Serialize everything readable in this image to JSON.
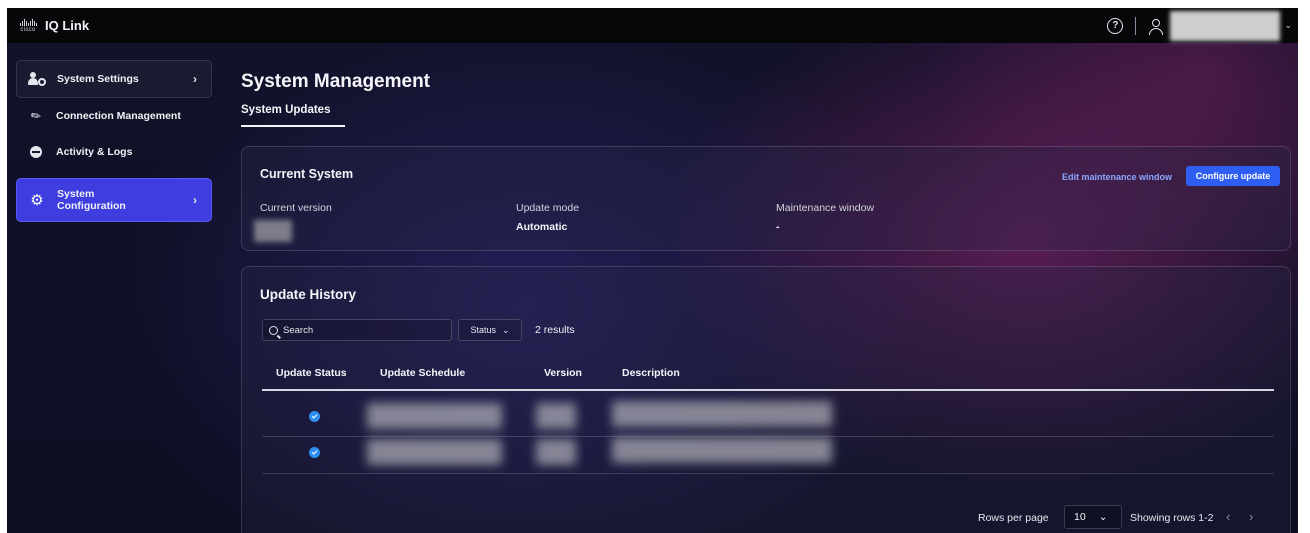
{
  "app": {
    "name": "IQ Link",
    "logo_text": "cisco"
  },
  "topbar": {
    "help_icon": "help-circle-icon",
    "user_icon": "user-icon",
    "chevron": "chevron-down-icon"
  },
  "sidebar": {
    "items": [
      {
        "label": "System Settings",
        "icon": "users-gear-icon",
        "has_chevron": true
      },
      {
        "label": "Connection Management",
        "icon": "plug-icon"
      },
      {
        "label": "Activity & Logs",
        "icon": "activity-icon"
      },
      {
        "label_line1": "System",
        "label_line2": "Configuration",
        "icon": "gear-icon",
        "active": true,
        "has_chevron": true
      }
    ],
    "chevron": "›"
  },
  "page": {
    "title": "System Management",
    "tab": "System Updates"
  },
  "current_system": {
    "title": "Current System",
    "edit_link": "Edit maintenance window",
    "configure_button": "Configure update",
    "fields": [
      {
        "label": "Current version",
        "value": ""
      },
      {
        "label": "Update mode",
        "value": "Automatic"
      },
      {
        "label": "Maintenance window",
        "value": "-"
      }
    ]
  },
  "update_history": {
    "title": "Update History",
    "search": {
      "placeholder": "Search",
      "value": ""
    },
    "status_filter": "Status",
    "results": "2 results",
    "columns": [
      "Update Status",
      "Update Schedule",
      "Version",
      "Description"
    ],
    "rows": [
      {
        "status": "success"
      },
      {
        "status": "success"
      }
    ],
    "pagination": {
      "rows_per_page_label": "Rows per page",
      "rows_per_page": "10",
      "showing": "Showing rows 1-2",
      "prev": "‹",
      "next": "›"
    }
  },
  "colors": {
    "accent": "#3d3de0",
    "primary_button": "#2f5ff2",
    "link": "#8aa6ff",
    "success": "#2f8ff0"
  }
}
